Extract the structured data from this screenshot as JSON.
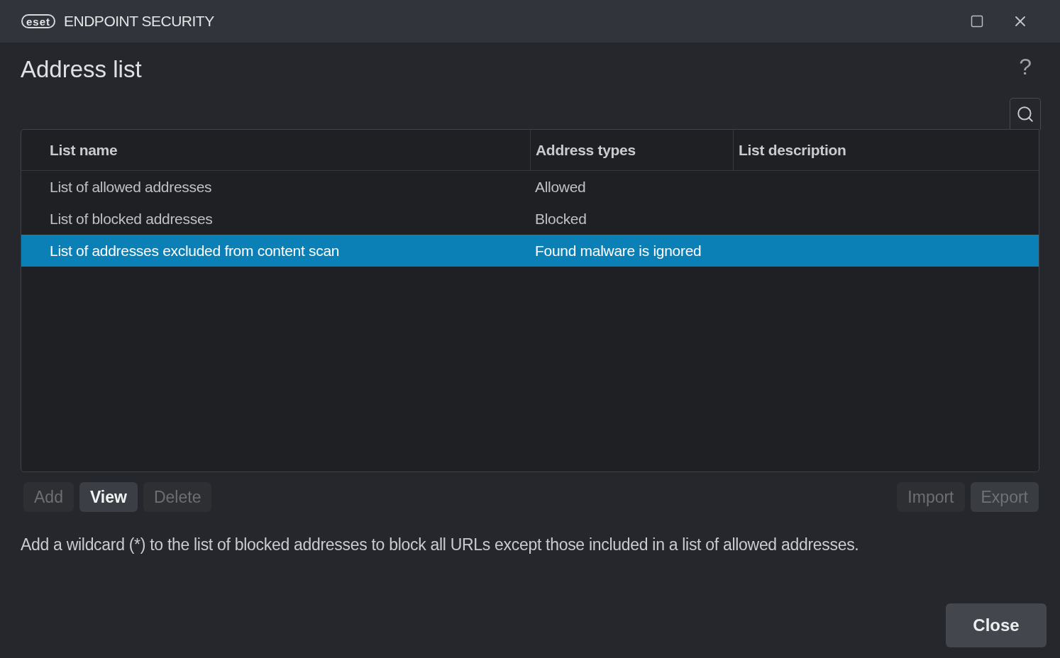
{
  "window": {
    "logo_text": "eset",
    "title": "ENDPOINT SECURITY"
  },
  "heading": "Address list",
  "help": "?",
  "table": {
    "columns": [
      "List name",
      "Address types",
      "List description"
    ],
    "rows": [
      {
        "cells": [
          "List of allowed addresses",
          "Allowed"
        ],
        "selected": false
      },
      {
        "cells": [
          "List of blocked addresses",
          "Blocked"
        ],
        "selected": false
      },
      {
        "cells": [
          "List of addresses excluded from content scan",
          "Found malware is ignored"
        ],
        "selected": true
      }
    ]
  },
  "left_buttons": [
    {
      "label": "Add",
      "disabled": true
    },
    {
      "label": "View",
      "disabled": false
    },
    {
      "label": "Delete",
      "disabled": true
    }
  ],
  "right_buttons": [
    {
      "label": "Import",
      "disabled": true
    },
    {
      "label": "Export",
      "disabled": true
    }
  ],
  "hint": "Add a wildcard (*) to the list of blocked addresses to block all URLs except those included in a list of allowed addresses.",
  "close_button": "Close"
}
